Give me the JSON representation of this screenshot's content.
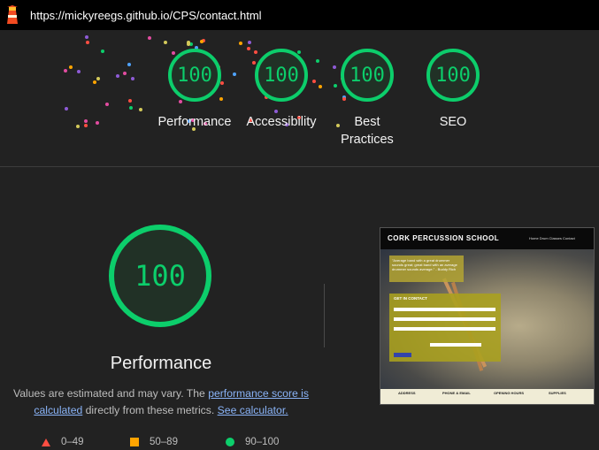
{
  "browser": {
    "url": "https://mickyreegs.github.io/CPS/contact.html"
  },
  "colors": {
    "pass": "#0cce6b",
    "average": "#ffa400",
    "fail": "#ff4e42"
  },
  "summary": [
    {
      "score": "100",
      "label": "Performance"
    },
    {
      "score": "100",
      "label": "Accessibility"
    },
    {
      "score": "100",
      "label": "Best Practices"
    },
    {
      "score": "100",
      "label": "SEO"
    }
  ],
  "main": {
    "score": "100",
    "title": "Performance",
    "note_prefix": "Values are estimated and may vary. The ",
    "note_link": "performance score is calculated",
    "note_middle": " directly from these metrics. ",
    "note_link2": "See calculator."
  },
  "legend": [
    {
      "range": "0–49",
      "icon": "triangle-icon"
    },
    {
      "range": "50–89",
      "icon": "square-icon"
    },
    {
      "range": "90–100",
      "icon": "circle-icon"
    }
  ],
  "screenshot": {
    "brand": "CORK PERCUSSION SCHOOL",
    "nav": "Home  Drum Classes  Contact",
    "quote": "\"Average band with a great drummer sounds great; great band with an average drummer sounds average.\" - Buddy Rich",
    "form_title": "GET IN CONTACT",
    "footer": [
      "ADDRESS",
      "PHONE & EMAIL",
      "OPENING HOURS",
      "SUPPLIES"
    ]
  }
}
